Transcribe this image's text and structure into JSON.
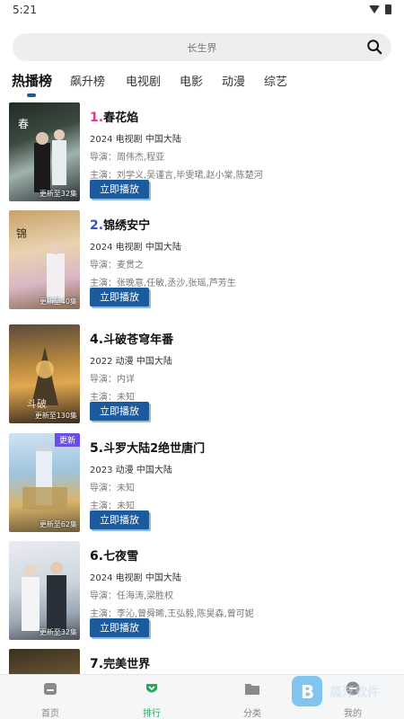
{
  "status": {
    "time": "5:21"
  },
  "search": {
    "placeholder": "长生界"
  },
  "tabs": [
    {
      "label": "热播榜",
      "active": true
    },
    {
      "label": "飙升榜"
    },
    {
      "label": "电视剧"
    },
    {
      "label": "电影"
    },
    {
      "label": "动漫"
    },
    {
      "label": "综艺"
    }
  ],
  "items": [
    {
      "rank": "1.",
      "title": "春花焰",
      "rank_color": "#e0398f",
      "year": "2024",
      "type": "电视剧",
      "region": "中国大陆",
      "director": "导演：周伟杰,程亚",
      "cast": "主演：刘学义,吴谨言,毕雯珺,赵小棠,陈楚河",
      "update": "更新至32集",
      "play": "立即播放"
    },
    {
      "rank": "2.",
      "title": "锦绣安宁",
      "rank_color": "#3a51b8",
      "year": "2024",
      "type": "电视剧",
      "region": "中国大陆",
      "director": "导演：麦贯之",
      "cast": "主演：张晚意,任敏,丞沙,张瑶,芦芳生",
      "update": "更新至40集",
      "play": "立即播放"
    },
    {
      "rank": "4.",
      "title": "斗破苍穹年番",
      "rank_color": "#111111",
      "year": "2022",
      "type": "动漫",
      "region": "中国大陆",
      "director": "导演：内详",
      "cast": "主演：未知",
      "update": "更新至130集",
      "play": "立即播放"
    },
    {
      "rank": "5.",
      "title": "斗罗大陆2绝世唐门",
      "rank_color": "#111111",
      "year": "2023",
      "type": "动漫",
      "region": "中国大陆",
      "director": "导演：未知",
      "cast": "主演：未知",
      "update": "更新至62集",
      "badge": "更新",
      "play": "立即播放"
    },
    {
      "rank": "6.",
      "title": "七夜雪",
      "rank_color": "#111111",
      "year": "2024",
      "type": "电视剧",
      "region": "中国大陆",
      "director": "导演：任海涛,梁胜权",
      "cast": "主演：李沁,曾舜晞,王弘毅,陈昊森,曾可妮",
      "update": "更新至32集",
      "play": "立即播放"
    },
    {
      "rank": "7.",
      "title": "完美世界",
      "rank_color": "#111111"
    }
  ],
  "nav": [
    {
      "label": "首页",
      "icon": "home-icon"
    },
    {
      "label": "排行",
      "icon": "ranking-icon",
      "active": true
    },
    {
      "label": "分类",
      "icon": "folder-icon"
    },
    {
      "label": "我的",
      "icon": "profile-icon"
    }
  ],
  "watermark": {
    "text": "晨浮软件"
  },
  "colors": {
    "accent": "#1b5a9d",
    "nav_active": "#2aa55a"
  }
}
